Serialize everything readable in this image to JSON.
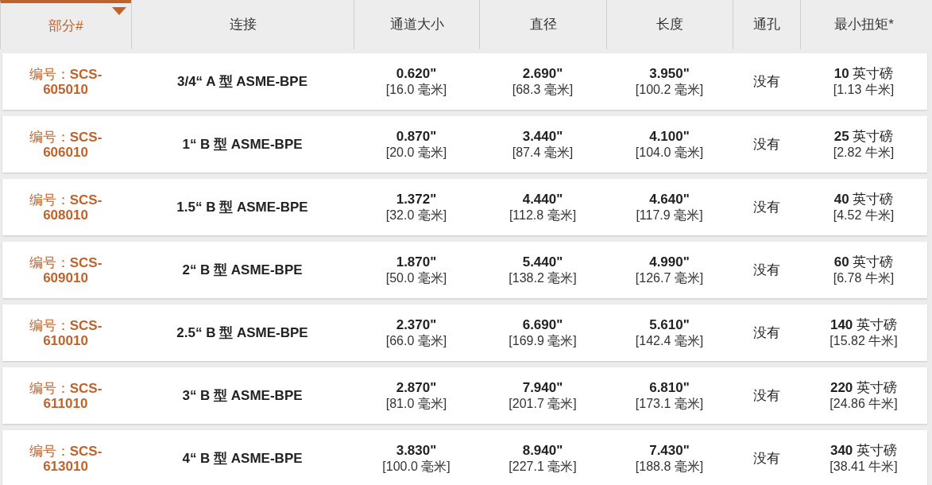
{
  "columns": [
    {
      "label": "部分#",
      "sorted": true
    },
    {
      "label": "连接",
      "sorted": false
    },
    {
      "label": "通道大小",
      "sorted": false
    },
    {
      "label": "直径",
      "sorted": false
    },
    {
      "label": "长度",
      "sorted": false
    },
    {
      "label": "通孔",
      "sorted": false
    },
    {
      "label": "最小扭矩*",
      "sorted": false
    }
  ],
  "rows": [
    {
      "part": "编号：**SCS-605010**",
      "connection": "3/4“ A 型 ASME-BPE",
      "bore": [
        "0.620\"",
        "[16.0 毫米]"
      ],
      "diameter": [
        "2.690\"",
        "[68.3 毫米]"
      ],
      "length": [
        "3.950\"",
        "[100.2 毫米]"
      ],
      "through_hole": "没有",
      "torque": [
        "**10** 英寸磅",
        "[1.13 牛米]"
      ]
    },
    {
      "part": "编号：**SCS-606010**",
      "connection": "1“ B 型 ASME-BPE",
      "bore": [
        "0.870\"",
        "[20.0 毫米]"
      ],
      "diameter": [
        "3.440\"",
        "[87.4 毫米]"
      ],
      "length": [
        "4.100\"",
        "[104.0 毫米]"
      ],
      "through_hole": "没有",
      "torque": [
        "**25** 英寸磅",
        "[2.82 牛米]"
      ]
    },
    {
      "part": "编号：**SCS-608010**",
      "connection": "1.5“ B 型 ASME-BPE",
      "bore": [
        "1.372\"",
        "[32.0 毫米]"
      ],
      "diameter": [
        "4.440\"",
        "[112.8 毫米]"
      ],
      "length": [
        "4.640\"",
        "[117.9 毫米]"
      ],
      "through_hole": "没有",
      "torque": [
        "**40** 英寸磅",
        "[4.52 牛米]"
      ]
    },
    {
      "part": "编号：**SCS-609010**",
      "connection": "2“ B 型 ASME-BPE",
      "bore": [
        "1.870\"",
        "[50.0 毫米]"
      ],
      "diameter": [
        "5.440\"",
        "[138.2 毫米]"
      ],
      "length": [
        "4.990\"",
        "[126.7 毫米]"
      ],
      "through_hole": "没有",
      "torque": [
        "**60** 英寸磅",
        "[6.78 牛米]"
      ]
    },
    {
      "part": "编号：**SCS-610010**",
      "connection": "2.5“ B 型 ASME-BPE",
      "bore": [
        "2.370\"",
        "[66.0 毫米]"
      ],
      "diameter": [
        "6.690\"",
        "[169.9 毫米]"
      ],
      "length": [
        "5.610\"",
        "[142.4 毫米]"
      ],
      "through_hole": "没有",
      "torque": [
        "**140** 英寸磅",
        "[15.82 牛米]"
      ]
    },
    {
      "part": "编号：**SCS-611010**",
      "connection": "3“ B 型 ASME-BPE",
      "bore": [
        "2.870\"",
        "[81.0 毫米]"
      ],
      "diameter": [
        "7.940\"",
        "[201.7 毫米]"
      ],
      "length": [
        "6.810\"",
        "[173.1 毫米]"
      ],
      "through_hole": "没有",
      "torque": [
        "**220** 英寸磅",
        "[24.86 牛米]"
      ]
    },
    {
      "part": "编号：**SCS-613010**",
      "connection": "4“ B 型 ASME-BPE",
      "bore": [
        "3.830\"",
        "[100.0 毫米]"
      ],
      "diameter": [
        "8.940\"",
        "[227.1 毫米]"
      ],
      "length": [
        "7.430\"",
        "[188.8 毫米]"
      ],
      "through_hole": "没有",
      "torque": [
        "**340** 英寸磅",
        "[38.41 牛米]"
      ]
    }
  ]
}
